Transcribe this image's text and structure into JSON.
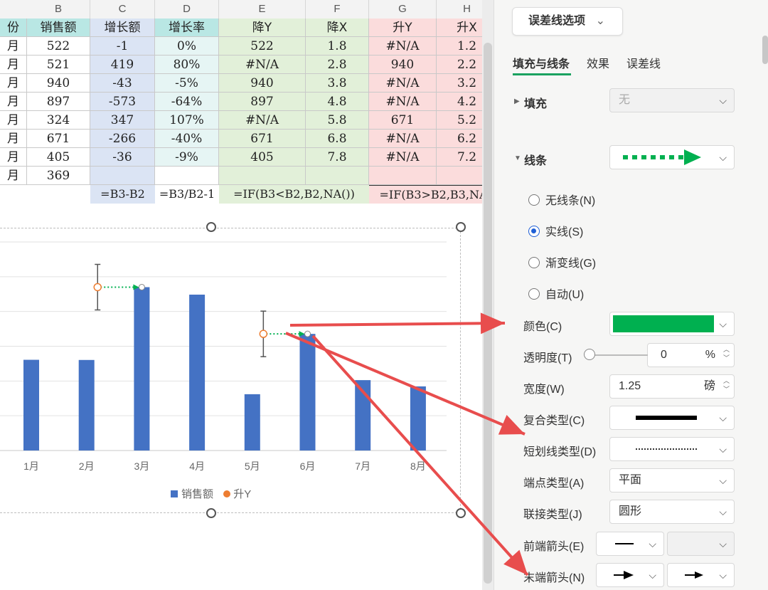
{
  "sheet": {
    "columns": [
      "B",
      "C",
      "D",
      "E",
      "F",
      "G",
      "H"
    ],
    "row_header_labels": [
      "份",
      "月",
      "月",
      "月",
      "月",
      "月",
      "月",
      "月",
      "月"
    ],
    "headers": [
      "销售额",
      "增长额",
      "增长率",
      "降Y",
      "降X",
      "升Y",
      "升X"
    ],
    "rows": [
      [
        "522",
        "-1",
        "0%",
        "522",
        "1.8",
        "#N/A",
        "1.2"
      ],
      [
        "521",
        "419",
        "80%",
        "#N/A",
        "2.8",
        "940",
        "2.2"
      ],
      [
        "940",
        "-43",
        "-5%",
        "940",
        "3.8",
        "#N/A",
        "3.2"
      ],
      [
        "897",
        "-573",
        "-64%",
        "897",
        "4.8",
        "#N/A",
        "4.2"
      ],
      [
        "324",
        "347",
        "107%",
        "#N/A",
        "5.8",
        "671",
        "5.2"
      ],
      [
        "671",
        "-266",
        "-40%",
        "671",
        "6.8",
        "#N/A",
        "6.2"
      ],
      [
        "405",
        "-36",
        "-9%",
        "405",
        "7.8",
        "#N/A",
        "7.2"
      ],
      [
        "369",
        "",
        "",
        "",
        "",
        "",
        ""
      ]
    ],
    "formulas": [
      "",
      "=B3-B2",
      "=B3/B2-1",
      "=IF(B3<B2,B2,NA())",
      "",
      "=IF(B3>B2,B3,NA",
      ""
    ]
  },
  "chart_data": {
    "type": "bar",
    "categories": [
      "1月",
      "2月",
      "3月",
      "4月",
      "5月",
      "6月",
      "7月",
      "8月"
    ],
    "series": [
      {
        "name": "销售额",
        "values": [
          522,
          521,
          940,
          897,
          324,
          671,
          405,
          369
        ],
        "color": "#4472c4"
      },
      {
        "name": "升Y",
        "type": "scatter",
        "x": [
          2.2,
          5.2
        ],
        "values": [
          940,
          671
        ],
        "color": "#ed7d31"
      }
    ],
    "ylim": [
      0,
      1200
    ],
    "grid": true,
    "legend_position": "bottom",
    "legend": [
      "销售额",
      "升Y"
    ]
  },
  "panel": {
    "dropdown_label": "误差线选项",
    "tabs": [
      "填充与线条",
      "效果",
      "误差线"
    ],
    "fill": {
      "title": "填充",
      "value": "无"
    },
    "line": {
      "title": "线条"
    },
    "radios": [
      "无线条(N)",
      "实线(S)",
      "渐变线(G)",
      "自动(U)"
    ],
    "selected_radio": 1,
    "color_label": "颜色(C)",
    "color_value": "#00b050",
    "transparency_label": "透明度(T)",
    "transparency_value": "0",
    "transparency_unit": "%",
    "width_label": "宽度(W)",
    "width_value": "1.25",
    "width_unit": "磅",
    "compound_label": "复合类型(C)",
    "dash_label": "短划线类型(D)",
    "cap_label": "端点类型(A)",
    "cap_value": "平面",
    "join_label": "联接类型(J)",
    "join_value": "圆形",
    "begin_arrow_label": "前端箭头(E)",
    "end_arrow_label": "末端箭头(N)"
  },
  "colors": {
    "accent": "#1aa260",
    "annotation_arrow": "#e84d4d",
    "col_c_fill": "#dbe4f4",
    "col_d_fill": "#e6f5f4",
    "col_ef_fill": "#e2f0d9",
    "col_gh_fill": "#fbdcdc",
    "header_b_fill": "#b9e7e4"
  }
}
